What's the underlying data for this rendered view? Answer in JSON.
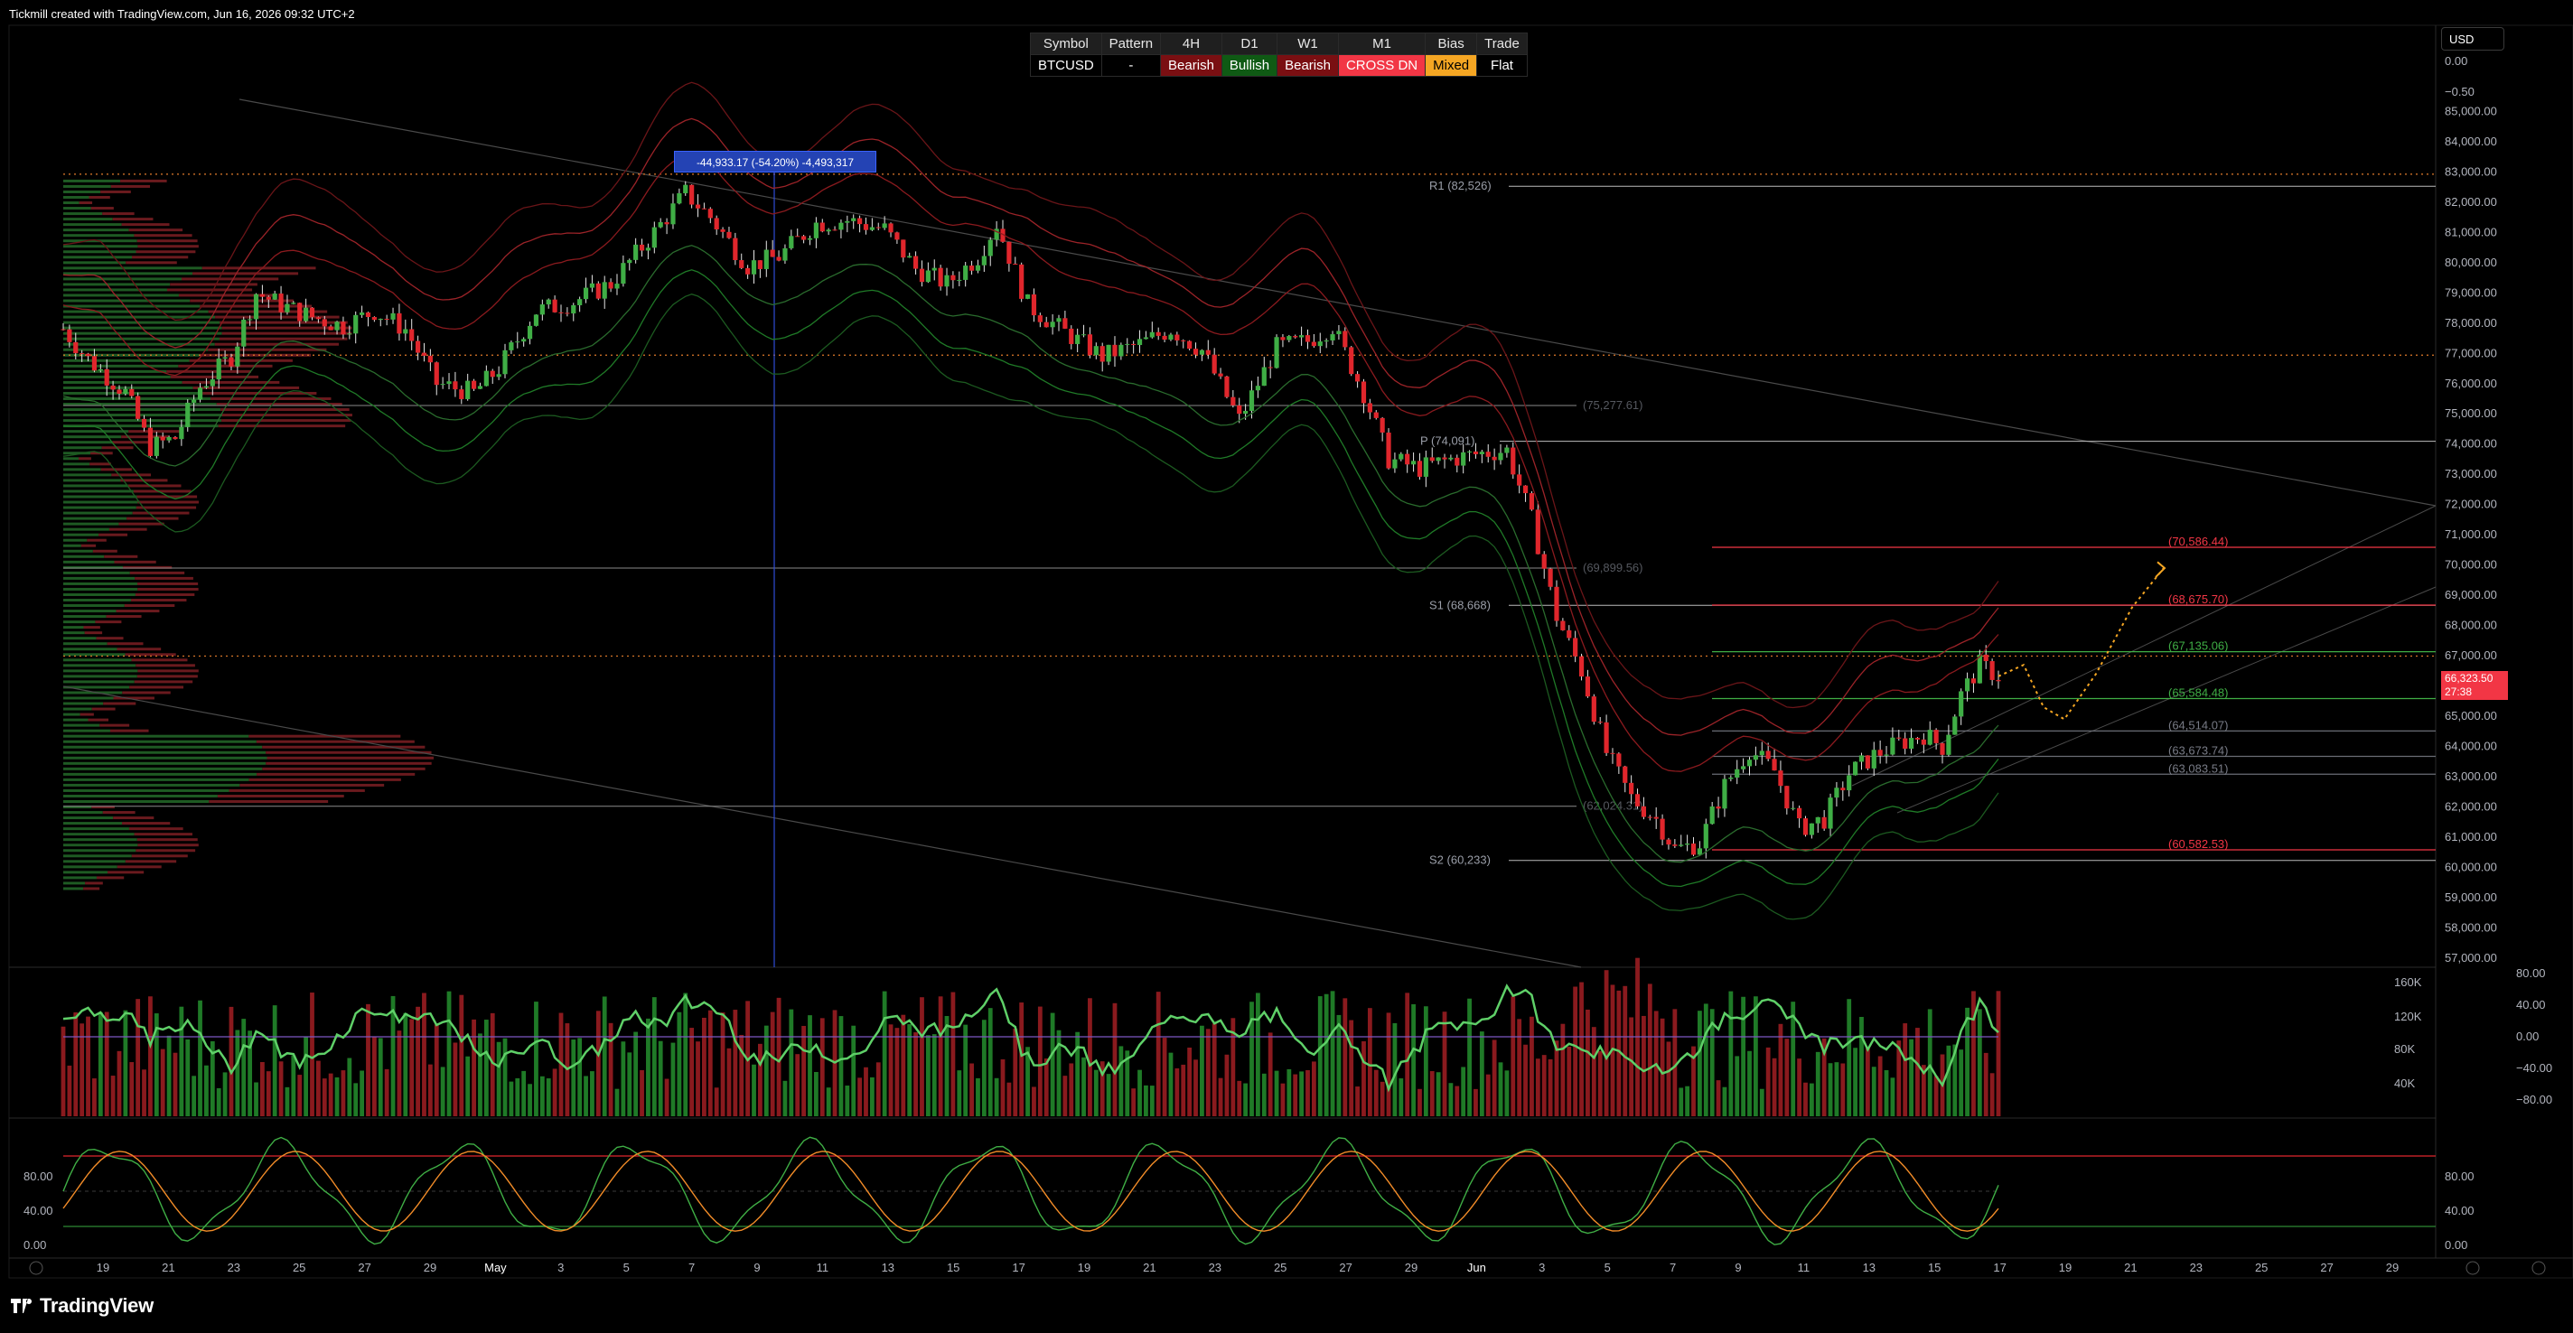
{
  "header": {
    "attribution": "Tickmill created with TradingView.com, Jun 16, 2026 09:32 UTC+2"
  },
  "status_table": {
    "headers": [
      "Symbol",
      "Pattern",
      "4H",
      "D1",
      "W1",
      "M1",
      "Bias",
      "Trade"
    ],
    "values": [
      "BTCUSD",
      "-",
      "Bearish",
      "Bullish",
      "Bearish",
      "CROSS DN",
      "Mixed",
      "Flat"
    ],
    "colors": [
      "#000000",
      "#000000",
      "#7a0f12",
      "#0f5a14",
      "#7a0f12",
      "#f23645",
      "#f5a623",
      "#000000"
    ]
  },
  "currency": "USD",
  "measure_label": "-44,933.17 (-54.20%) -4,493,317",
  "price_tag": {
    "price": "66,323.50",
    "countdown": "27:38"
  },
  "brand": "TradingView",
  "colors": {
    "bull": "#26a69a",
    "bear": "#f23645",
    "green": "#3fae45",
    "red": "#e0262c",
    "grid": "#1a1a1a",
    "axis_text": "#b2b5be"
  },
  "chart_data": [
    {
      "type": "candlestick",
      "symbol": "BTCUSD",
      "y_axis_ticks": [
        "85,000.00",
        "84,000.00",
        "83,000.00",
        "82,000.00",
        "81,000.00",
        "80,000.00",
        "79,000.00",
        "78,000.00",
        "77,000.00",
        "76,000.00",
        "75,000.00",
        "74,000.00",
        "73,000.00",
        "72,000.00",
        "71,000.00",
        "70,000.00",
        "69,000.00",
        "68,000.00",
        "67,000.00",
        "66,000.00",
        "65,000.00",
        "64,000.00",
        "63,000.00",
        "62,000.00",
        "61,000.00",
        "60,000.00",
        "59,000.00",
        "58,000.00",
        "57,000.00"
      ],
      "y_axis_top_labels": [
        "0.00",
        "−0.50"
      ],
      "ylim": [
        56700,
        85400
      ],
      "x_axis_labels": [
        "19",
        "21",
        "23",
        "25",
        "27",
        "29",
        "May",
        "3",
        "5",
        "7",
        "9",
        "11",
        "13",
        "15",
        "17",
        "19",
        "21",
        "23",
        "25",
        "27",
        "29",
        "Jun",
        "3",
        "5",
        "7",
        "9",
        "11",
        "13",
        "15",
        "17",
        "19",
        "21",
        "23",
        "25",
        "27",
        "29"
      ],
      "price_path": [
        [
          0,
          77800
        ],
        [
          4,
          76800
        ],
        [
          10,
          75700
        ],
        [
          14,
          73900
        ],
        [
          18,
          74200
        ],
        [
          22,
          75900
        ],
        [
          27,
          76900
        ],
        [
          31,
          79000
        ],
        [
          35,
          78600
        ],
        [
          40,
          78200
        ],
        [
          45,
          77900
        ],
        [
          50,
          78400
        ],
        [
          55,
          77800
        ],
        [
          60,
          76000
        ],
        [
          66,
          75700
        ],
        [
          70,
          76500
        ],
        [
          76,
          78400
        ],
        [
          82,
          78700
        ],
        [
          88,
          79300
        ],
        [
          95,
          81000
        ],
        [
          100,
          82300
        ],
        [
          104,
          81500
        ],
        [
          110,
          79900
        ],
        [
          115,
          80200
        ],
        [
          121,
          81300
        ],
        [
          126,
          81400
        ],
        [
          132,
          81100
        ],
        [
          137,
          79800
        ],
        [
          142,
          79300
        ],
        [
          147,
          80200
        ],
        [
          150,
          81300
        ],
        [
          155,
          78600
        ],
        [
          161,
          77700
        ],
        [
          167,
          76900
        ],
        [
          173,
          77300
        ],
        [
          178,
          77800
        ],
        [
          183,
          77100
        ],
        [
          189,
          74800
        ],
        [
          195,
          77200
        ],
        [
          200,
          77400
        ],
        [
          204,
          77900
        ],
        [
          209,
          75700
        ],
        [
          213,
          73500
        ],
        [
          218,
          73200
        ],
        [
          223,
          73500
        ],
        [
          228,
          73700
        ],
        [
          232,
          73800
        ],
        [
          236,
          71500
        ],
        [
          240,
          68300
        ],
        [
          244,
          66500
        ],
        [
          248,
          63800
        ],
        [
          252,
          62300
        ],
        [
          256,
          61600
        ],
        [
          259,
          60600
        ],
        [
          263,
          60800
        ],
        [
          267,
          62700
        ],
        [
          271,
          63900
        ],
        [
          275,
          63200
        ],
        [
          279,
          61300
        ],
        [
          283,
          61600
        ],
        [
          287,
          63100
        ],
        [
          291,
          63700
        ],
        [
          295,
          64100
        ],
        [
          299,
          64400
        ],
        [
          302,
          64000
        ],
        [
          305,
          65700
        ],
        [
          308,
          66700
        ],
        [
          311,
          66323.5
        ]
      ],
      "key_levels": [
        {
          "label": "R1 (82,526)",
          "price": 82526
        },
        {
          "label": "P (74,091)",
          "price": 74091
        },
        {
          "label": "S1 (68,668)",
          "price": 68668
        },
        {
          "label": "S2 (60,233)",
          "price": 60233
        }
      ],
      "price_labels": [
        {
          "label": "(75,277.61)",
          "price": 75277.61
        },
        {
          "label": "(69,899.56)",
          "price": 69899.56
        },
        {
          "label": "(62,024.31)",
          "price": 62024.31
        },
        {
          "label": "(70,586.44)",
          "price": 70586.44,
          "color": "#f23645"
        },
        {
          "label": "(68,675.70)",
          "price": 68675.7,
          "color": "#f23645"
        },
        {
          "label": "(67,135.06)",
          "price": 67135.06,
          "color": "#3fae45"
        },
        {
          "label": "(65,584.48)",
          "price": 65584.48,
          "color": "#3fae45"
        },
        {
          "label": "(64,514.07)",
          "price": 64514.07,
          "color": "#787b86"
        },
        {
          "label": "(63,673.74)",
          "price": 63673.74,
          "color": "#787b86"
        },
        {
          "label": "(63,083.51)",
          "price": 63083.51,
          "color": "#787b86"
        },
        {
          "label": "(60,582.53)",
          "price": 60582.53,
          "color": "#f23645"
        }
      ],
      "dotted_levels": [
        82926,
        76940,
        66990
      ]
    },
    {
      "type": "bar",
      "name": "volume",
      "y_axis_left": [
        "160K",
        "120K",
        "80K",
        "40K"
      ],
      "y_axis_right": [
        "80.00",
        "40.00",
        "0.00",
        "−40.00",
        "−80.00"
      ]
    },
    {
      "type": "line",
      "name": "stochastic",
      "y_axis_ticks": [
        "80.00",
        "40.00",
        "0.00"
      ],
      "levels": [
        80,
        20
      ]
    }
  ]
}
